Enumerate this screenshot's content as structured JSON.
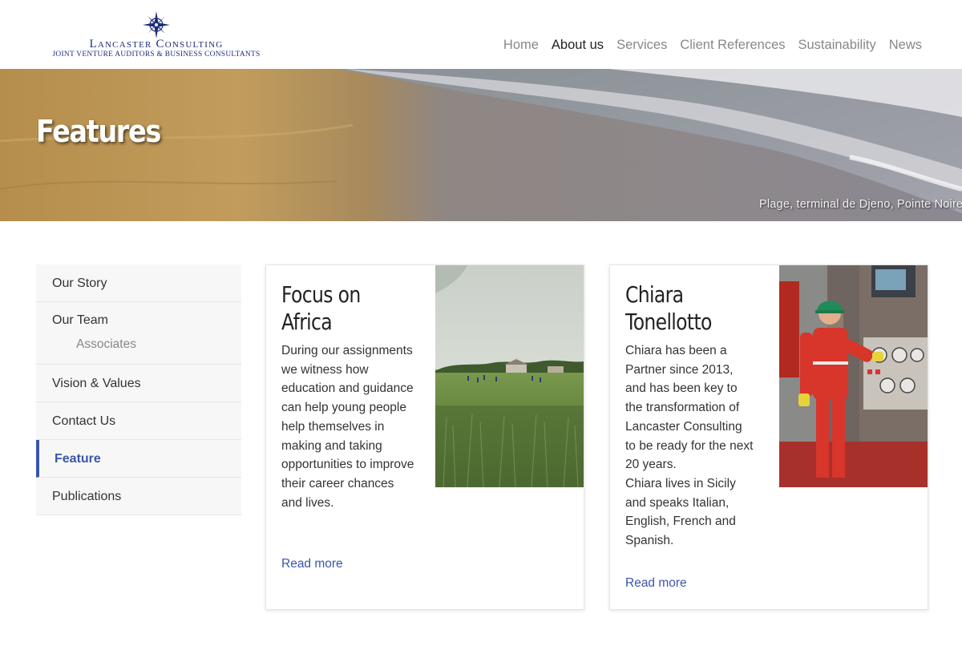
{
  "brand": {
    "name": "Lancaster Consulting",
    "tagline": "Joint Venture Auditors & Business Consultants",
    "logo_icon": "compass-star-icon",
    "color": "#1d2c78"
  },
  "nav": {
    "items": [
      {
        "label": "Home",
        "active": false
      },
      {
        "label": "About us",
        "active": true
      },
      {
        "label": "Services",
        "active": false
      },
      {
        "label": "Client References",
        "active": false
      },
      {
        "label": "Sustainability",
        "active": false
      },
      {
        "label": "News",
        "active": false
      }
    ]
  },
  "hero": {
    "title": "Features",
    "caption": "Plage, terminal de Djeno, Pointe Noire"
  },
  "sidebar": {
    "items": [
      {
        "label": "Our Story"
      },
      {
        "label": "Our Team",
        "sub": "Associates"
      },
      {
        "label": "Vision & Values"
      },
      {
        "label": "Contact Us"
      },
      {
        "label": "Feature",
        "active": true
      },
      {
        "label": "Publications"
      }
    ],
    "accent_color": "#3a56a8"
  },
  "cards": [
    {
      "title": "Focus on Africa",
      "body": "During our assignments we witness how education and guidance can help young people help themselves in making and taking opportunities to improve their career chances and lives.",
      "link": "Read more"
    },
    {
      "title": "Chiara Tonellotto",
      "body1": "Chiara has been a Partner since 2013, and has been key to the transformation of Lancaster Consulting to be ready for the next 20 years.",
      "body2": "Chiara lives in Sicily and speaks Italian, English, French and Spanish.",
      "link": "Read more"
    }
  ]
}
